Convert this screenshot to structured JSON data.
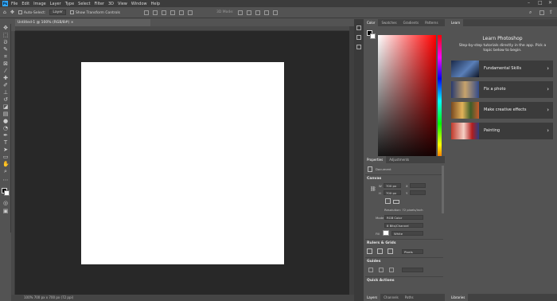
{
  "menubar": {
    "items": [
      "File",
      "Edit",
      "Image",
      "Layer",
      "Type",
      "Select",
      "Filter",
      "3D",
      "View",
      "Window",
      "Help"
    ],
    "window_controls": [
      "–",
      "□",
      "✕"
    ]
  },
  "options": {
    "auto_select_label": "Auto-Select:",
    "target_value": "Layer",
    "transform_label": "Show Transform Controls",
    "mode_label": "3D Mode:"
  },
  "document": {
    "tab_title": "Untitled-1 @ 100% (RGB/8#) ×",
    "status": "100%    700 px x 700 px (72 ppi)"
  },
  "color_panel": {
    "tabs": [
      "Color",
      "Swatches",
      "Gradients",
      "Patterns"
    ]
  },
  "properties_panel": {
    "tabs": [
      "Properties",
      "Adjustments"
    ],
    "doc_label": "Document",
    "canvas_header": "Canvas",
    "w_label": "W",
    "w_value": "700 px",
    "h_label": "H",
    "h_value": "700 px",
    "x_label": "X",
    "y_label": "Y",
    "resolution": "Resolution: 72 pixels/inch",
    "mode_label": "Mode",
    "mode_value": "RGB Color",
    "depth_value": "8 Bits/Channel",
    "fill_label": "Fill",
    "fill_value": "White",
    "rulers_header": "Rulers & Grids",
    "units_value": "Pixels",
    "guides_header": "Guides",
    "quick_actions_header": "Quick Actions"
  },
  "layers_panel": {
    "tabs": [
      "Layers",
      "Channels",
      "Paths"
    ]
  },
  "learn_panel": {
    "tab": "Learn",
    "title": "Learn Photoshop",
    "subtitle": "Step-by-step tutorials directly in the app. Pick a topic below to begin.",
    "cards": [
      {
        "label": "Fundamental Skills"
      },
      {
        "label": "Fix a photo"
      },
      {
        "label": "Make creative effects"
      },
      {
        "label": "Painting"
      }
    ]
  },
  "libraries_panel": {
    "tab": "Libraries"
  },
  "colors": {
    "accent": "#31a8ff",
    "pasteboard": "#282828",
    "panel": "#535353",
    "canvas": "#ffffff"
  }
}
